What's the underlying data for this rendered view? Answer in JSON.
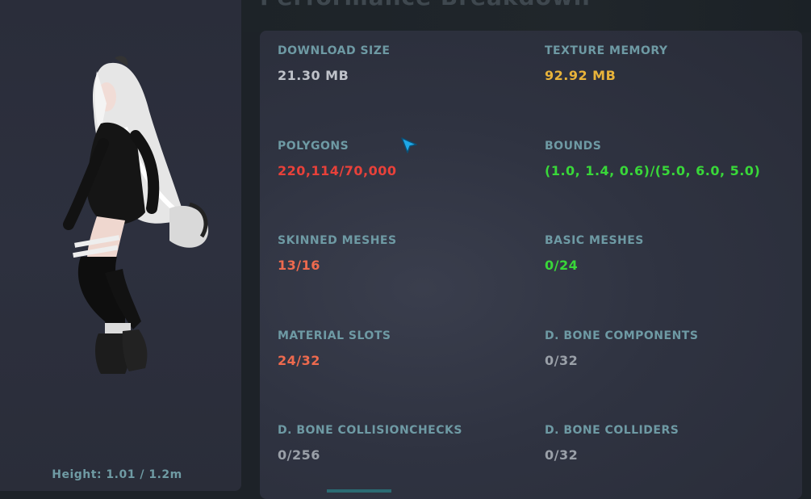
{
  "page": {
    "title": "Performance Breakdown"
  },
  "avatar_preview": {
    "height_text": "Height: 1.01 / 1.2m"
  },
  "colors": {
    "label": "#6e9aa4",
    "neutral": "#bfc2c9",
    "warning": "#e8b33a",
    "bad": "#e8413a",
    "poor": "#ee6a4e",
    "good": "#39d739",
    "muted": "#9aa0a8"
  },
  "stats": [
    {
      "label": "DOWNLOAD SIZE",
      "value": "21.30 MB",
      "color": "#bfc2c9"
    },
    {
      "label": "TEXTURE MEMORY",
      "value": "92.92 MB",
      "color": "#e8b33a"
    },
    {
      "label": "POLYGONS",
      "value": "220,114/70,000",
      "color": "#e8413a"
    },
    {
      "label": "BOUNDS",
      "value": "(1.0, 1.4, 0.6)/(5.0, 6.0, 5.0)",
      "color": "#39d739"
    },
    {
      "label": "SKINNED MESHES",
      "value": "13/16",
      "color": "#ee6a4e"
    },
    {
      "label": "BASIC MESHES",
      "value": "0/24",
      "color": "#39d739"
    },
    {
      "label": "MATERIAL SLOTS",
      "value": "24/32",
      "color": "#ee6a4e"
    },
    {
      "label": "D. BONE COMPONENTS",
      "value": "0/32",
      "color": "#9aa0a8"
    },
    {
      "label": "D. BONE COLLISIONCHECKS",
      "value": "0/256",
      "color": "#9aa0a8"
    },
    {
      "label": "D. BONE COLLIDERS",
      "value": "0/32",
      "color": "#9aa0a8"
    }
  ]
}
